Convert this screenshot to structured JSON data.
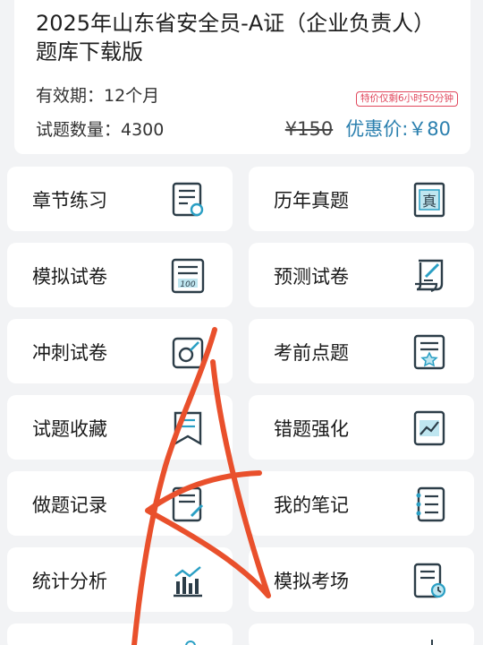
{
  "product": {
    "title": "2025年山东省安全员-A证（企业负责人）题库下载版",
    "validity": "有效期：12个月",
    "count": "试题数量：4300",
    "promo_badge": "特价仅剩6小时50分钟",
    "old_price": "¥150",
    "new_price": "优惠价:￥80"
  },
  "colors": {
    "accent": "#2a7fae",
    "promo": "#e0475c",
    "annotation": "#e9502c"
  },
  "menu": [
    {
      "label": "章节练习",
      "icon": "chapter-practice-icon"
    },
    {
      "label": "历年真题",
      "icon": "past-exams-icon"
    },
    {
      "label": "模拟试卷",
      "icon": "mock-paper-icon"
    },
    {
      "label": "预测试卷",
      "icon": "predict-paper-icon"
    },
    {
      "label": "冲刺试卷",
      "icon": "sprint-paper-icon"
    },
    {
      "label": "考前点题",
      "icon": "key-points-icon"
    },
    {
      "label": "试题收藏",
      "icon": "favorites-icon"
    },
    {
      "label": "错题强化",
      "icon": "wrong-questions-icon"
    },
    {
      "label": "做题记录",
      "icon": "record-icon"
    },
    {
      "label": "我的笔记",
      "icon": "notes-icon"
    },
    {
      "label": "统计分析",
      "icon": "statistics-icon"
    },
    {
      "label": "模拟考场",
      "icon": "exam-room-icon"
    }
  ]
}
